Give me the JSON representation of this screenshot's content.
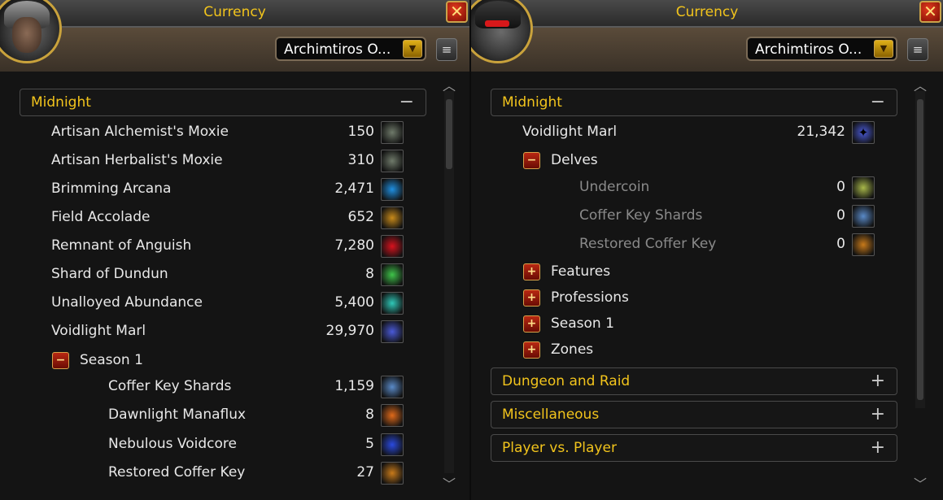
{
  "left": {
    "title": "Currency",
    "close_icon": "close-icon",
    "character": "Archimtiros O...",
    "category": {
      "label": "Midnight",
      "toggle": "−"
    },
    "items": [
      {
        "name": "Artisan Alchemist's Moxie",
        "value": "150",
        "icon": "moxie-icon",
        "color": "#6f7a6a"
      },
      {
        "name": "Artisan Herbalist's Moxie",
        "value": "310",
        "icon": "moxie-icon",
        "color": "#6f7a6a"
      },
      {
        "name": "Brimming Arcana",
        "value": "2,471",
        "icon": "arcana-orb-icon",
        "color": "#1f8fe0"
      },
      {
        "name": "Field Accolade",
        "value": "652",
        "icon": "accolade-icon",
        "color": "#c88a1a"
      },
      {
        "name": "Remnant of Anguish",
        "value": "7,280",
        "icon": "anguish-gem-icon",
        "color": "#d8121e"
      },
      {
        "name": "Shard of Dundun",
        "value": "8",
        "icon": "dundun-shard-icon",
        "color": "#3fc44a"
      },
      {
        "name": "Unalloyed Abundance",
        "value": "5,400",
        "icon": "abundance-icon",
        "color": "#2fc8b8"
      },
      {
        "name": "Voidlight Marl",
        "value": "29,970",
        "icon": "voidlight-icon",
        "color": "#4a5ad8"
      }
    ],
    "season": {
      "label": "Season 1",
      "toggle": "−"
    },
    "season_items": [
      {
        "name": "Coffer Key Shards",
        "value": "1,159",
        "icon": "coffer-shard-icon",
        "color": "#5a8ac8"
      },
      {
        "name": "Dawnlight Manaflux",
        "value": "8",
        "icon": "manaflux-icon",
        "color": "#e06a1a"
      },
      {
        "name": "Nebulous Voidcore",
        "value": "5",
        "icon": "voidcore-icon",
        "color": "#2a4ae0"
      },
      {
        "name": "Restored Coffer Key",
        "value": "27",
        "icon": "coffer-key-icon",
        "color": "#c87a1a"
      }
    ]
  },
  "right": {
    "title": "Currency",
    "character": "Archimtiros O...",
    "category": {
      "label": "Midnight",
      "toggle": "−"
    },
    "top_item": {
      "name": "Voidlight Marl",
      "value": "21,342",
      "icon": "voidlight-icon",
      "color": "#4a5ad8"
    },
    "delves": {
      "label": "Delves",
      "toggle": "−"
    },
    "delves_items": [
      {
        "name": "Undercoin",
        "value": "0",
        "icon": "undercoin-icon",
        "color": "#a8b84a"
      },
      {
        "name": "Coffer Key Shards",
        "value": "0",
        "icon": "coffer-shard-icon",
        "color": "#5a8ac8"
      },
      {
        "name": "Restored Coffer Key",
        "value": "0",
        "icon": "coffer-key-icon",
        "color": "#c87a1a"
      }
    ],
    "subgroups": [
      {
        "label": "Features",
        "toggle": "+"
      },
      {
        "label": "Professions",
        "toggle": "+"
      },
      {
        "label": "Season 1",
        "toggle": "+"
      },
      {
        "label": "Zones",
        "toggle": "+"
      }
    ],
    "categories": [
      {
        "label": "Dungeon and Raid",
        "toggle": "+"
      },
      {
        "label": "Miscellaneous",
        "toggle": "+"
      },
      {
        "label": "Player vs. Player",
        "toggle": "+"
      }
    ]
  },
  "colors": {
    "gold": "#f2c41c",
    "text": "#e8e8e8",
    "dim": "#8a8a8a"
  }
}
